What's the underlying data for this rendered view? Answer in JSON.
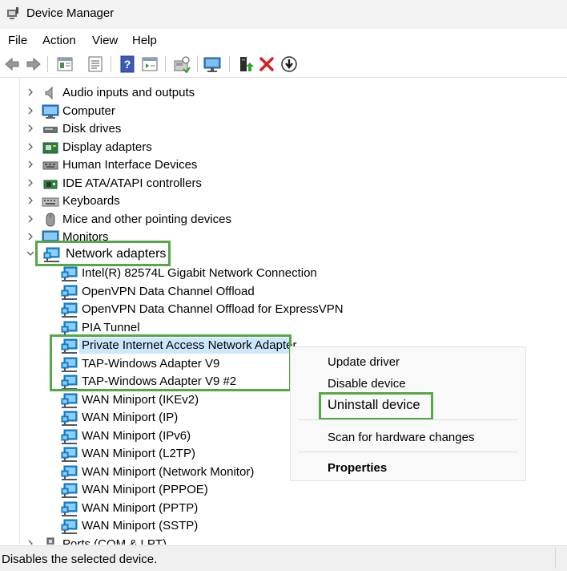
{
  "window": {
    "title": "Device Manager"
  },
  "menu": [
    "File",
    "Action",
    "View",
    "Help"
  ],
  "toolbar": [
    "back-icon",
    "forward-icon",
    "properties-icon",
    "help-icon",
    "scan-icon",
    "monitor-icon",
    "update-driver-icon",
    "uninstall-icon",
    "disable-icon"
  ],
  "tree": {
    "categories": [
      {
        "label": "Audio inputs and outputs",
        "icon": "speaker-icon"
      },
      {
        "label": "Computer",
        "icon": "computer-icon"
      },
      {
        "label": "Disk drives",
        "icon": "disk-drive-icon"
      },
      {
        "label": "Display adapters",
        "icon": "display-adapter-icon"
      },
      {
        "label": "Human Interface Devices",
        "icon": "hid-icon"
      },
      {
        "label": "IDE ATA/ATAPI controllers",
        "icon": "ide-controller-icon"
      },
      {
        "label": "Keyboards",
        "icon": "keyboard-icon"
      },
      {
        "label": "Mice and other pointing devices",
        "icon": "mouse-icon"
      },
      {
        "label": "Monitors",
        "icon": "monitor-icon"
      }
    ],
    "network": {
      "label": "Network adapters",
      "children": [
        "Intel(R) 82574L Gigabit Network Connection",
        "OpenVPN Data Channel Offload",
        "OpenVPN Data Channel Offload for ExpressVPN",
        "PIA Tunnel",
        "Private Internet Access Network Adapter",
        "TAP-Windows Adapter V9",
        "TAP-Windows Adapter V9 #2",
        "WAN Miniport (IKEv2)",
        "WAN Miniport (IP)",
        "WAN Miniport (IPv6)",
        "WAN Miniport (L2TP)",
        "WAN Miniport (Network Monitor)",
        "WAN Miniport (PPPOE)",
        "WAN Miniport (PPTP)",
        "WAN Miniport (SSTP)"
      ]
    },
    "after": [
      {
        "label": "Ports (COM & LPT)",
        "icon": "port-icon"
      }
    ]
  },
  "context_menu": {
    "update": "Update driver",
    "disable": "Disable device",
    "uninstall": "Uninstall device",
    "scan": "Scan for hardware changes",
    "properties": "Properties"
  },
  "status": {
    "text": "Disables the selected device."
  },
  "colors": {
    "highlight": "#55a845",
    "selection": "#cce8ff",
    "net_icon": "#1e8fe0"
  }
}
